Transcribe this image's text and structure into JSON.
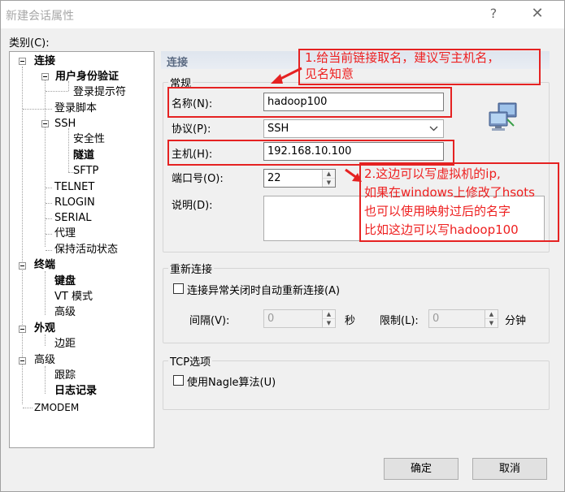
{
  "window": {
    "title": "新建会话属性",
    "help": "?",
    "close": "✕"
  },
  "category_label": "类别(C):",
  "tree": [
    {
      "label": "连接",
      "bold": true
    },
    {
      "label": "用户身份验证",
      "bold": true
    },
    {
      "label": "登录提示符",
      "bold": false
    },
    {
      "label": "登录脚本",
      "bold": false
    },
    {
      "label": "SSH",
      "bold": false
    },
    {
      "label": "安全性",
      "bold": false
    },
    {
      "label": "隧道",
      "bold": true
    },
    {
      "label": "SFTP",
      "bold": false
    },
    {
      "label": "TELNET",
      "bold": false
    },
    {
      "label": "RLOGIN",
      "bold": false
    },
    {
      "label": "SERIAL",
      "bold": false
    },
    {
      "label": "代理",
      "bold": false
    },
    {
      "label": "保持活动状态",
      "bold": false
    },
    {
      "label": "终端",
      "bold": true
    },
    {
      "label": "键盘",
      "bold": true
    },
    {
      "label": "VT 模式",
      "bold": false
    },
    {
      "label": "高级",
      "bold": false
    },
    {
      "label": "外观",
      "bold": true
    },
    {
      "label": "边距",
      "bold": false
    },
    {
      "label": "高级",
      "bold": false
    },
    {
      "label": "跟踪",
      "bold": false
    },
    {
      "label": "日志记录",
      "bold": true
    },
    {
      "label": "ZMODEM",
      "bold": false
    }
  ],
  "panel": {
    "header": "连接",
    "general": {
      "title": "常规",
      "name_label": "名称(N):",
      "name_value": "hadoop100",
      "protocol_label": "协议(P):",
      "protocol_value": "SSH",
      "host_label": "主机(H):",
      "host_value": "192.168.10.100",
      "port_label": "端口号(O):",
      "port_value": "22",
      "desc_label": "说明(D):"
    },
    "reconnect": {
      "title": "重新连接",
      "checkbox_label": "连接异常关闭时自动重新连接(A)",
      "interval_label": "间隔(V):",
      "interval_value": "0",
      "interval_unit": "秒",
      "limit_label": "限制(L):",
      "limit_value": "0",
      "limit_unit": "分钟"
    },
    "tcp": {
      "title": "TCP选项",
      "checkbox_label": "使用Nagle算法(U)"
    }
  },
  "buttons": {
    "ok": "确定",
    "cancel": "取消"
  },
  "annotations": {
    "note1_line1": "1.给当前链接取名，建议写主机名，",
    "note1_line2": "见名知意",
    "note2_line1": "2.这边可以写虚拟机的ip,",
    "note2_line2": "如果在windows上修改了hsots",
    "note2_line3": "也可以使用映射过后的名字",
    "note2_line4": "比如这边可以写hadoop100"
  },
  "colors": {
    "annotation_red": "#e52222",
    "panel_header_text": "#5a6a82"
  }
}
